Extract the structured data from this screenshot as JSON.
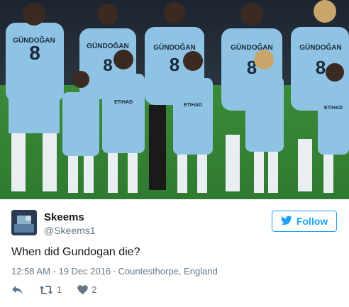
{
  "photo": {
    "description_icon": "photo-image",
    "shirt_text": [
      "GÜNDOĞAN",
      "GÜNDOĞAN",
      "GÜNDOĞAN",
      "GÜNDOĞAN",
      "GÜNDOĞAN"
    ],
    "shirt_number": "8",
    "sponsor": "ETIHAD"
  },
  "user": {
    "display_name": "Skeems",
    "handle": "@Skeems1"
  },
  "follow_button": {
    "label": "Follow",
    "icon": "twitter-bird-icon"
  },
  "tweet": {
    "text": "When did Gundogan die?",
    "time": "12:58 AM - 19 Dec 2016",
    "location": "Countesthorpe, England",
    "separator": "·"
  },
  "actions": {
    "reply_icon": "reply-icon",
    "retweet_icon": "retweet-icon",
    "retweet_count": "1",
    "like_icon": "heart-icon",
    "like_count": "2"
  },
  "colors": {
    "twitter_blue": "#1da1f2",
    "secondary_text": "#657786",
    "shirt_blue": "#8fc3e4",
    "pitch_green": "#3f8a3a"
  }
}
